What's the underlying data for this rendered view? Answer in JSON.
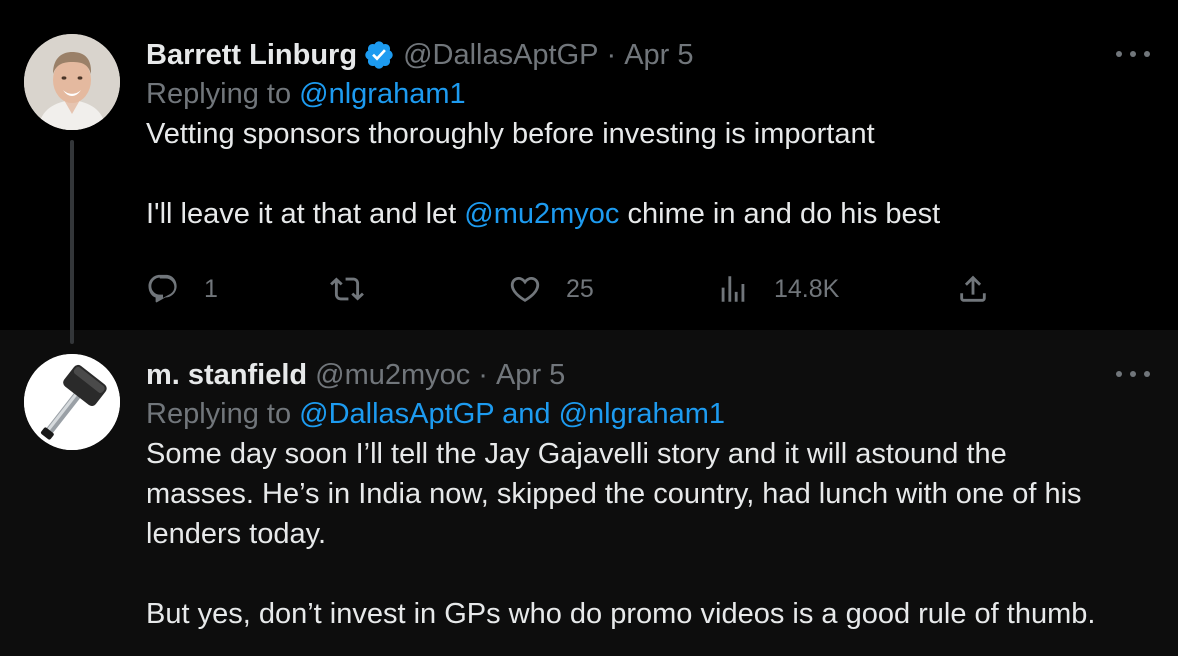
{
  "tweets": [
    {
      "name": "Barrett Linburg",
      "verified": true,
      "handle": "@DallasAptGP",
      "dot": "·",
      "date": "Apr 5",
      "replying_prefix": "Replying to",
      "replying_to": "@nlgraham1",
      "body_line1": "Vetting sponsors thoroughly before investing is important",
      "body_line2_before": "I'll leave it at that and let",
      "body_line2_mention": "@mu2myoc",
      "body_line2_after": "chime in and do his best",
      "actions": {
        "replies": "1",
        "retweets": "",
        "likes": "25",
        "views": "14.8K"
      }
    },
    {
      "name": "m. stanfield",
      "handle": "@mu2myoc",
      "dot": "·",
      "date": "Apr 5",
      "replying_prefix": "Replying to",
      "replying_to": "@DallasAptGP and @nlgraham1",
      "body_p1_l1": "Some day soon I’ll tell the Jay Gajavelli story and it will astound the",
      "body_p1_l2": "masses. He’s in India now, skipped the country, had lunch with one of his",
      "body_p1_l3": "lenders today.",
      "body_p2": "But yes, don’t invest in GPs who do promo videos is a good rule of thumb."
    }
  ],
  "colors": {
    "background": "#000000",
    "text": "#e7e9ea",
    "muted": "#71767b",
    "link": "#1d9bf0",
    "verified": "#1d9bf0"
  },
  "icons": [
    "verified-badge-icon",
    "more-icon",
    "reply-icon",
    "retweet-icon",
    "like-icon",
    "views-icon",
    "share-icon"
  ]
}
